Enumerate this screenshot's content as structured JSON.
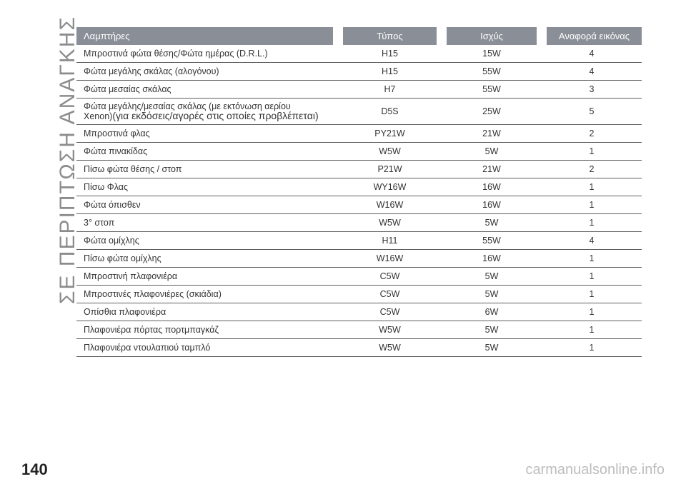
{
  "side_title": "ΣΕ ΠΕΡΙΠΤΩΣΗ ΑΝΑΓΚΗΣ",
  "page_number": "140",
  "watermark": "carmanualsonline.info",
  "table": {
    "headers": [
      "Λαμπτήρες",
      "Τύπος",
      "Ισχύς",
      "Αναφορά εικόνας"
    ],
    "rows": [
      {
        "lamp": "Μπροστινά φώτα θέσης/Φώτα ημέρας (D.R.L.)",
        "type": "H15",
        "power": "15W",
        "ref": "4"
      },
      {
        "lamp": "Φώτα μεγάλης σκάλας (αλογόνου)",
        "type": "H15",
        "power": "55W",
        "ref": "4"
      },
      {
        "lamp": "Φώτα μεσαίας σκάλας",
        "type": "H7",
        "power": "55W",
        "ref": "3"
      },
      {
        "lamp": "Φώτα μεγάλης/μεσαίας σκάλας (με εκτόνωση αερίου",
        "lamp_line2a": "Xenon)",
        "lamp_line2b": "(για εκδόσεις/αγορές στις οποίες προβλέπεται)",
        "type": "D5S",
        "power": "25W",
        "ref": "5"
      },
      {
        "lamp": "Μπροστινά φλας",
        "type": "PY21W",
        "power": "21W",
        "ref": "2"
      },
      {
        "lamp": "Φώτα πινακίδας",
        "type": "W5W",
        "power": "5W",
        "ref": "1"
      },
      {
        "lamp": "Πίσω φώτα θέσης / στοπ",
        "type": "P21W",
        "power": "21W",
        "ref": "2"
      },
      {
        "lamp": "Πίσω Φλας",
        "type": "WY16W",
        "power": "16W",
        "ref": "1"
      },
      {
        "lamp": "Φώτα όπισθεν",
        "type": "W16W",
        "power": "16W",
        "ref": "1"
      },
      {
        "lamp": "3° στοπ",
        "type": "W5W",
        "power": "5W",
        "ref": "1"
      },
      {
        "lamp": "Φώτα ομίχλης",
        "type": "H11",
        "power": "55W",
        "ref": "4"
      },
      {
        "lamp": "Πίσω φώτα ομίχλης",
        "type": "W16W",
        "power": "16W",
        "ref": "1"
      },
      {
        "lamp": "Μπροστινή πλαφονιέρα",
        "type": "C5W",
        "power": "5W",
        "ref": "1"
      },
      {
        "lamp": "Μπροστινές πλαφονιέρες (σκιάδια)",
        "type": "C5W",
        "power": "5W",
        "ref": "1"
      },
      {
        "lamp": "Οπίσθια πλαφονιέρα",
        "type": "C5W",
        "power": "6W",
        "ref": "1"
      },
      {
        "lamp": "Πλαφονιέρα πόρτας πορτμπαγκάζ",
        "type": "W5W",
        "power": "5W",
        "ref": "1"
      },
      {
        "lamp": "Πλαφονιέρα ντουλαπιού ταμπλό",
        "type": "W5W",
        "power": "5W",
        "ref": "1"
      }
    ]
  }
}
